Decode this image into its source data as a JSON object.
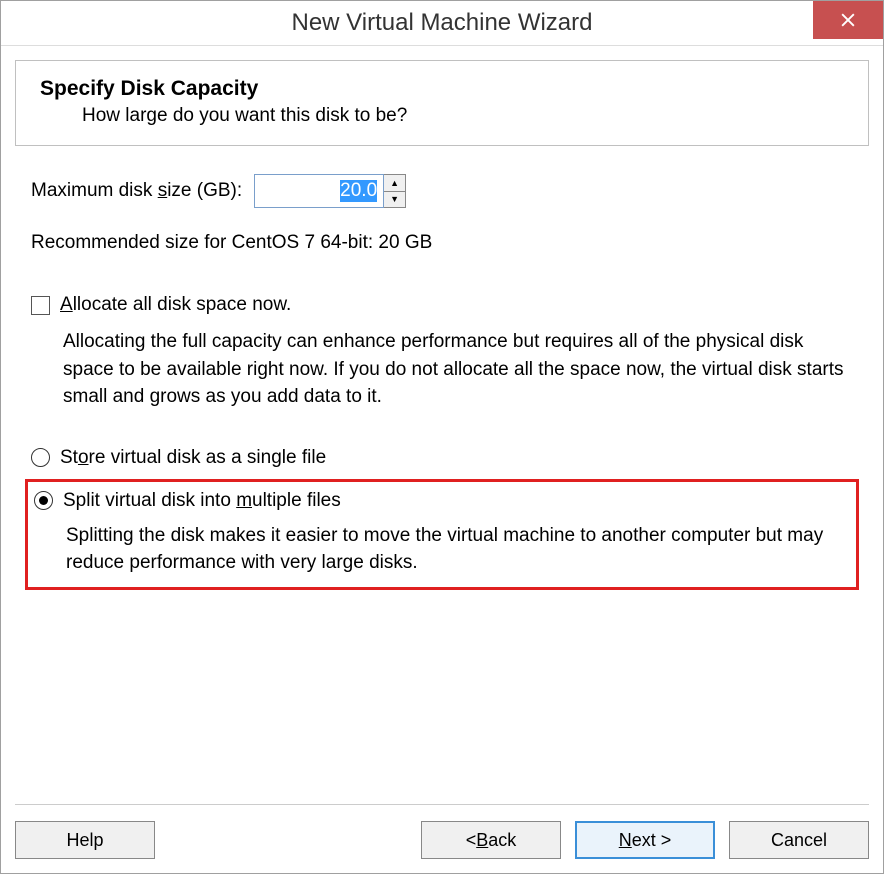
{
  "window": {
    "title": "New Virtual Machine Wizard"
  },
  "header": {
    "title": "Specify Disk Capacity",
    "subtitle": "How large do you want this disk to be?"
  },
  "disk": {
    "size_label_pre": "Maximum disk ",
    "size_label_u": "s",
    "size_label_post": "ize (GB):",
    "size_value": "20.0",
    "recommended": "Recommended size for CentOS 7 64-bit: 20 GB"
  },
  "allocate": {
    "label_u": "A",
    "label_post": "llocate all disk space now.",
    "desc": "Allocating the full capacity can enhance performance but requires all of the physical disk space to be available right now. If you do not allocate all the space now, the virtual disk starts small and grows as you add data to it.",
    "checked": false
  },
  "store_mode": {
    "single_pre": "St",
    "single_u": "o",
    "single_post": "re virtual disk as a single file",
    "split_pre": "Split virtual disk into ",
    "split_u": "m",
    "split_post": "ultiple files",
    "split_desc": "Splitting the disk makes it easier to move the virtual machine to another computer but may reduce performance with very large disks.",
    "selected": "split"
  },
  "buttons": {
    "help": "Help",
    "back_pre": "< ",
    "back_u": "B",
    "back_post": "ack",
    "next_u": "N",
    "next_post": "ext >",
    "cancel": "Cancel"
  }
}
